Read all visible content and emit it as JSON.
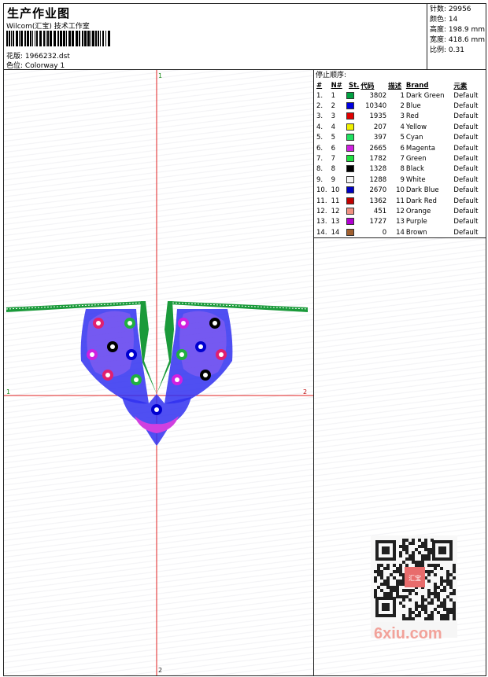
{
  "header": {
    "title": "生产作业图",
    "company": "Wilcom(汇宝) 技术工作室",
    "design_label": "花版:",
    "design_value": "1966232.dst",
    "colorway_label": "色位:",
    "colorway_value": "Colorway 1"
  },
  "stats": {
    "stitches": "针数: 29956",
    "colors": "颜色: 14",
    "height": "高度: 198.9 mm",
    "width": "宽度: 418.6 mm",
    "scale": "比例: 0.31"
  },
  "axes": {
    "top": "1",
    "bottom": "2",
    "left": "1",
    "right": "2"
  },
  "sequence": {
    "title": "停止顺序:",
    "headers": [
      "#",
      "N#",
      "St.",
      "代码",
      "描述",
      "Brand",
      "元素"
    ],
    "rows": [
      {
        "idx": "1.",
        "n": "1",
        "st": "3802",
        "code": "1",
        "desc": "Dark Green",
        "brand": "Default",
        "color": "#00a040"
      },
      {
        "idx": "2.",
        "n": "2",
        "st": "10340",
        "code": "2",
        "desc": "Blue",
        "brand": "Default",
        "color": "#0000e0"
      },
      {
        "idx": "3.",
        "n": "3",
        "st": "1935",
        "code": "3",
        "desc": "Red",
        "brand": "Default",
        "color": "#e00000"
      },
      {
        "idx": "4.",
        "n": "4",
        "st": "207",
        "code": "4",
        "desc": "Yellow",
        "brand": "Default",
        "color": "#f0f000"
      },
      {
        "idx": "5.",
        "n": "5",
        "st": "397",
        "code": "5",
        "desc": "Cyan",
        "brand": "Default",
        "color": "#20e060"
      },
      {
        "idx": "6.",
        "n": "6",
        "st": "2665",
        "code": "6",
        "desc": "Magenta",
        "brand": "Default",
        "color": "#d020e0"
      },
      {
        "idx": "7.",
        "n": "7",
        "st": "1782",
        "code": "7",
        "desc": "Green",
        "brand": "Default",
        "color": "#20e040"
      },
      {
        "idx": "8.",
        "n": "8",
        "st": "1328",
        "code": "8",
        "desc": "Black",
        "brand": "Default",
        "color": "#000000"
      },
      {
        "idx": "9.",
        "n": "9",
        "st": "1288",
        "code": "9",
        "desc": "White",
        "brand": "Default",
        "color": "#f4f4f4"
      },
      {
        "idx": "10.",
        "n": "10",
        "st": "2670",
        "code": "10",
        "desc": "Dark Blue",
        "brand": "Default",
        "color": "#0000c0"
      },
      {
        "idx": "11.",
        "n": "11",
        "st": "1362",
        "code": "11",
        "desc": "Dark Red",
        "brand": "Default",
        "color": "#c00000"
      },
      {
        "idx": "12.",
        "n": "12",
        "st": "451",
        "code": "12",
        "desc": "Orange",
        "brand": "Default",
        "color": "#f09080"
      },
      {
        "idx": "13.",
        "n": "13",
        "st": "1727",
        "code": "13",
        "desc": "Purple",
        "brand": "Default",
        "color": "#b000d0"
      },
      {
        "idx": "14.",
        "n": "14",
        "st": "0",
        "code": "14",
        "desc": "Brown",
        "brand": "Default",
        "color": "#a06030"
      }
    ]
  },
  "watermark": {
    "text": "6xiu.com",
    "seal_text": "汇宝"
  }
}
